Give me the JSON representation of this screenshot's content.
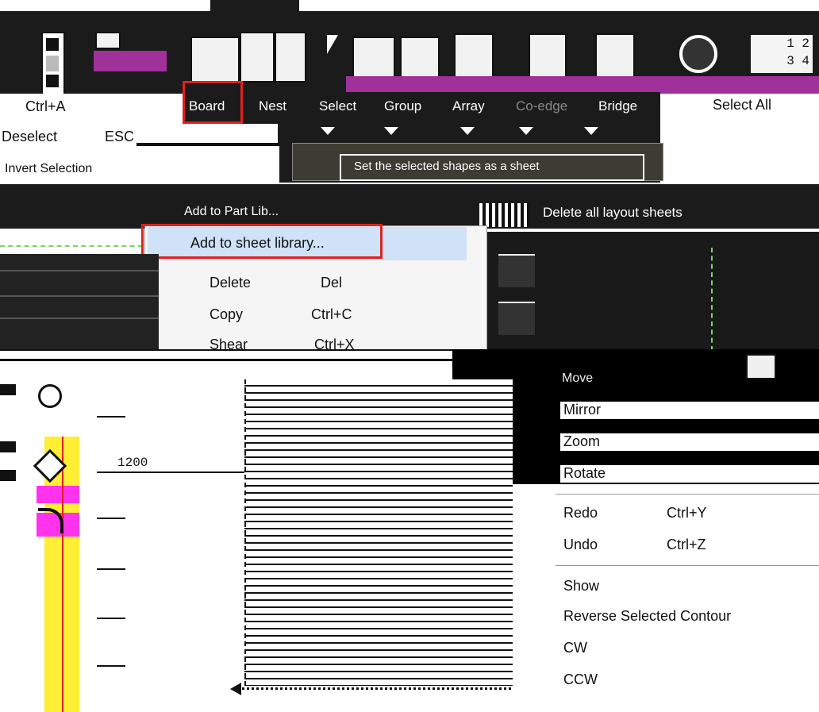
{
  "shortcuts": {
    "select_all_key": "Ctrl+A",
    "deselect": "Deselect",
    "deselect_key": "ESC",
    "invert": "Invert Selection"
  },
  "tabs": [
    "Board",
    "Nest",
    "Select",
    "Group",
    "Array",
    "Co-edge",
    "Bridge"
  ],
  "select_all_label": "Select All",
  "toolbar_numbers": [
    "1 2",
    "3 4"
  ],
  "tooltip": "Set the selected shapes as a sheet",
  "sheet_actions": {
    "add_part": "Add to Part Lib...",
    "delete_layout": "Delete all layout sheets"
  },
  "context_menu": {
    "items": [
      {
        "label": "Add to sheet library...",
        "key": ""
      },
      {
        "label": "Delete",
        "key": "Del"
      },
      {
        "label": "Copy",
        "key": "Ctrl+C"
      },
      {
        "label": "Shear",
        "key": "Ctrl+X"
      }
    ]
  },
  "right_menu": {
    "transform": [
      "Move",
      "Mirror",
      "Zoom",
      "Rotate"
    ],
    "history": [
      {
        "label": "Redo",
        "key": "Ctrl+Y"
      },
      {
        "label": "Undo",
        "key": "Ctrl+Z"
      }
    ],
    "contour": [
      "Show",
      "Reverse Selected Contour",
      "CW",
      "CCW"
    ]
  },
  "dimension": "1200",
  "colors": {
    "magenta": "#a0309a",
    "pink": "#ff33ee",
    "yellow": "#ffee33",
    "highlight": "#cfe2f7",
    "red": "#e02020",
    "green": "#7fd36a"
  }
}
